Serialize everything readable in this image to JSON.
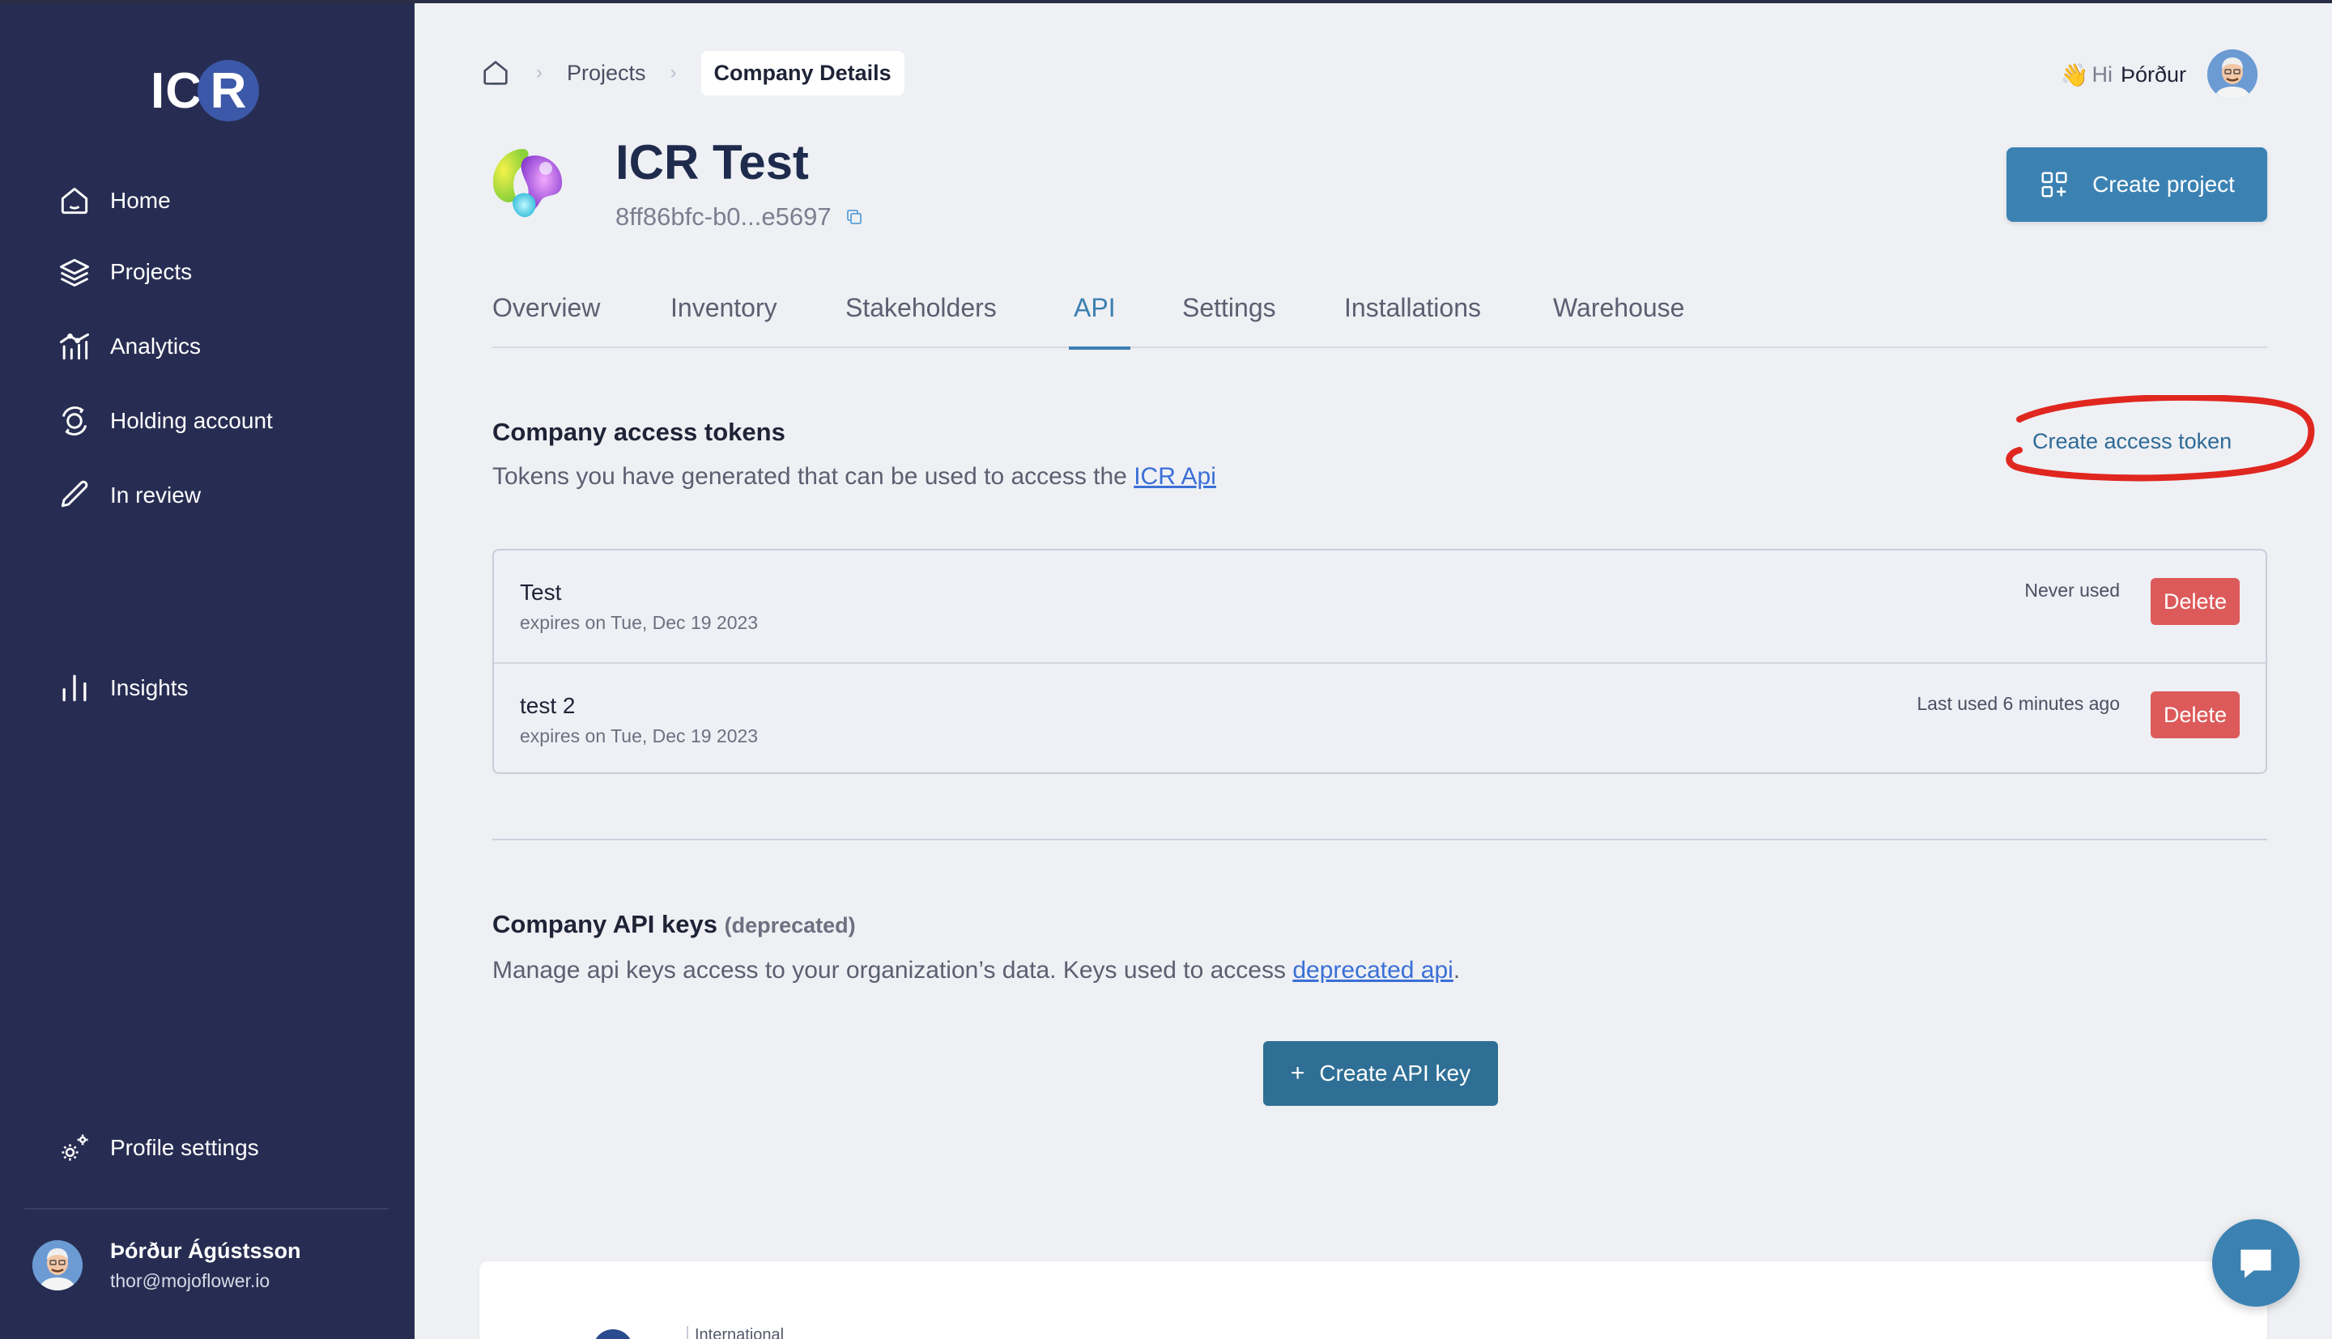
{
  "brand": {
    "logo_prefix": "IC",
    "logo_letter": "R"
  },
  "sidebar": {
    "items": [
      {
        "label": "Home",
        "icon": "home-icon"
      },
      {
        "label": "Projects",
        "icon": "layers-icon"
      },
      {
        "label": "Analytics",
        "icon": "analytics-icon"
      },
      {
        "label": "Holding account",
        "icon": "holding-icon"
      },
      {
        "label": "In review",
        "icon": "pencil-icon"
      },
      {
        "label": "Insights",
        "icon": "bar-chart-icon"
      }
    ],
    "profile_settings": "Profile settings"
  },
  "user": {
    "full_name": "Þórður Ágústsson",
    "email": "thor@mojoflower.io",
    "greeting_emoji": "👋",
    "greeting_hi": "Hi",
    "first_name": "Þórður"
  },
  "breadcrumb": {
    "items": [
      "Projects",
      "Company Details"
    ]
  },
  "project": {
    "title": "ICR Test",
    "id": "8ff86bfc-b0...e5697",
    "create_button": "Create project"
  },
  "tabs": [
    "Overview",
    "Inventory",
    "Stakeholders",
    "API",
    "Settings",
    "Installations",
    "Warehouse"
  ],
  "active_tab": "API",
  "tokens": {
    "title": "Company access tokens",
    "subtitle_prefix": "Tokens you have generated that can be used to access the ",
    "subtitle_link": "ICR Api",
    "create_link": "Create access token",
    "rows": [
      {
        "name": "Test",
        "expires": "expires on Tue, Dec 19 2023",
        "status": "Never used",
        "delete": "Delete"
      },
      {
        "name": "test 2",
        "expires": "expires on Tue, Dec 19 2023",
        "status": "Last used 6 minutes ago",
        "delete": "Delete"
      }
    ]
  },
  "api_keys": {
    "title": "Company API keys",
    "deprecated_tag": "(deprecated)",
    "subtitle_prefix": "Manage api keys access to your organization’s data. Keys used to access ",
    "subtitle_link": "deprecated api",
    "subtitle_suffix": ".",
    "create_button_plus": "+",
    "create_button": "Create API key"
  },
  "footer": {
    "org_text": "International"
  },
  "colors": {
    "sidebar_bg": "#272d52",
    "accent": "#3b82b3",
    "delete": "#dc5a5a",
    "annotation": "#e0271f",
    "link": "#3a6fd6"
  }
}
